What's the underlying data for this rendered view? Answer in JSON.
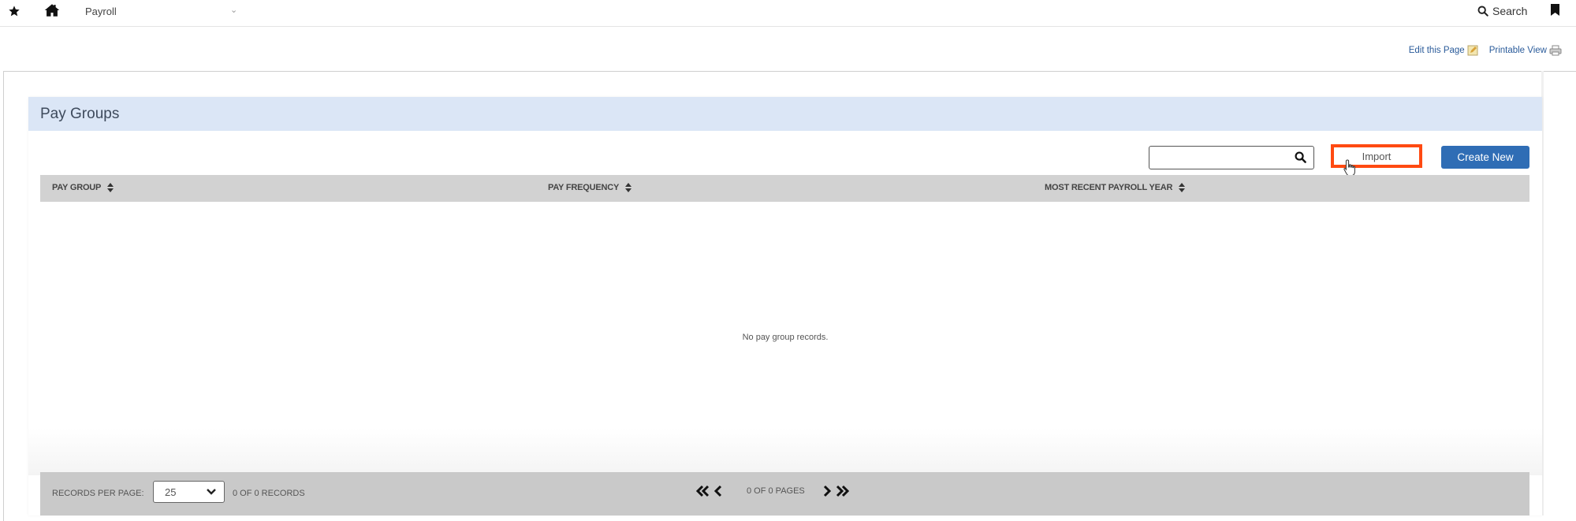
{
  "topbar": {
    "module": "Payroll",
    "search_label": "Search",
    "icons": [
      "star-icon",
      "home-icon",
      "chevron-down-icon",
      "search-icon",
      "bookmark-icon"
    ]
  },
  "page_tools": {
    "edit_label": "Edit this Page",
    "printable_label": "Printable View"
  },
  "panel": {
    "title": "Pay Groups",
    "search": {
      "value": "",
      "placeholder": ""
    },
    "import_label": "Import",
    "create_label": "Create New",
    "highlight_color": "#ff4a12",
    "primary_color": "#2f6db5",
    "header_bg": "#dbe6f6"
  },
  "table": {
    "columns": [
      {
        "label": "PAY GROUP"
      },
      {
        "label": "PAY FREQUENCY"
      },
      {
        "label": "MOST RECENT PAYROLL YEAR"
      }
    ],
    "rows": [],
    "empty_message": "No pay group records."
  },
  "footer": {
    "records_per_page_label": "RECORDS PER PAGE:",
    "records_per_page_value": "25",
    "records_count": "0 OF 0 RECORDS",
    "pages_label": "0 OF 0 PAGES"
  }
}
